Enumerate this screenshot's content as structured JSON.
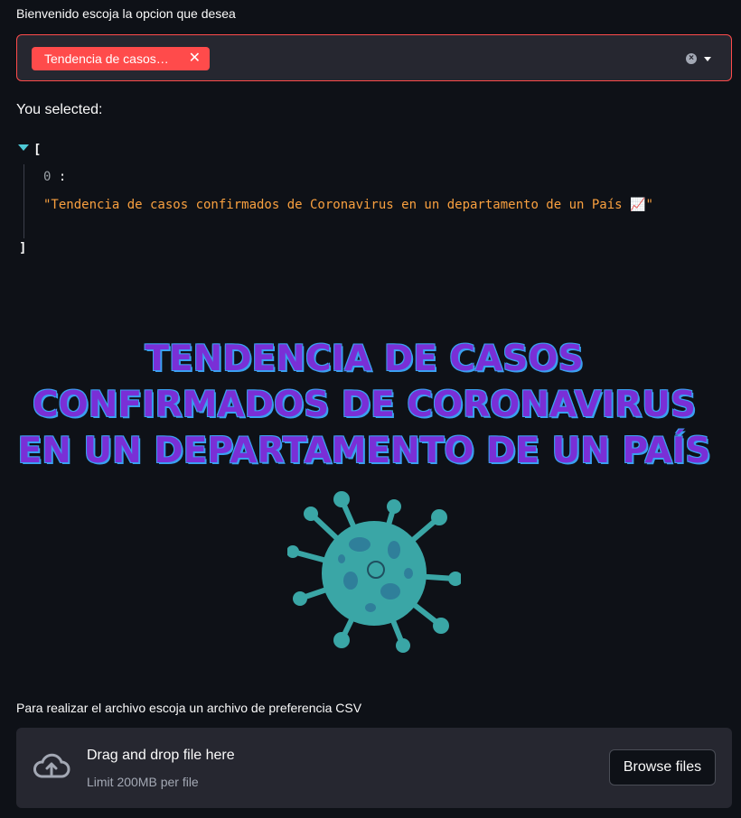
{
  "select": {
    "label": "Bienvenido escoja la opcion que desea",
    "chip_label": "Tendencia de casos…",
    "chip_remove": "✕",
    "clear": "×"
  },
  "output": {
    "you_selected": "You selected:",
    "open_bracket": "[",
    "index": "0",
    "colon": ":",
    "value": "\"Tendencia de casos confirmados de Coronavirus en un departamento de un País 📈\"",
    "close_bracket": "]"
  },
  "banner": {
    "line1": "TENDENCIA DE CASOS",
    "line2": "CONFIRMADOS DE CORONAVIRUS",
    "line3": "EN UN DEPARTAMENTO DE UN PAÍS"
  },
  "uploader": {
    "label": "Para realizar el archivo escoja un archivo de preferencia CSV",
    "drag_text": "Drag and drop file here",
    "limit_text": "Limit 200MB per file",
    "browse_label": "Browse files"
  },
  "colors": {
    "accent": "#ff4b4b",
    "background": "#0e1117",
    "widget": "#262730",
    "json_string": "#f9a03f",
    "banner_fill": "#7a2fd6",
    "banner_outline": "#3aa0f0",
    "virus": "#3aa6a6"
  },
  "icons": [
    "clear-icon",
    "chevron-down-icon",
    "collapse-toggle-icon",
    "virus-image",
    "cloud-upload-icon"
  ]
}
